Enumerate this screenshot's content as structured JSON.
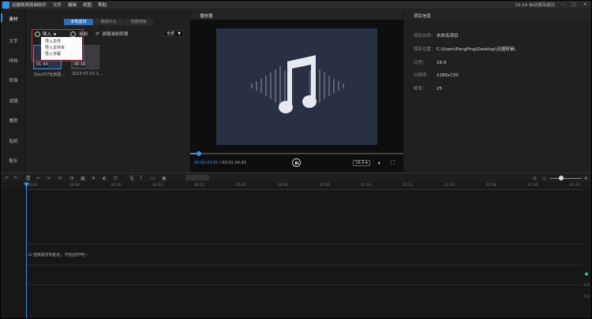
{
  "titlebar": {
    "app_title": "迅捷视频剪辑软件",
    "menu": [
      "文件",
      "编辑",
      "视图",
      "帮助"
    ],
    "save_status": "15:14 自动保存成功",
    "win_controls": [
      "–",
      "□",
      "✕"
    ]
  },
  "nav": [
    "素材",
    "文字",
    "特效",
    "转场",
    "滤镜",
    "叠附",
    "贴纸",
    "配乐"
  ],
  "library": {
    "tabs": [
      "本地素材",
      "视频片头",
      "背景特效"
    ],
    "import_label": "导入",
    "record_label": "录制",
    "capture_label": "屏幕录制转换",
    "filter_value": "全部",
    "dropdown_items": [
      "导入文件",
      "导入文件夹",
      "导入字幕"
    ],
    "thumbs": [
      {
        "duration": "01:34",
        "caption": "Day107远景图..."
      },
      {
        "duration": "00:16",
        "caption": "2023-07-23 1..."
      }
    ]
  },
  "player": {
    "title": "播放器",
    "current_time": "00:00:03.85",
    "total_time": "00:01:34.43",
    "ratio": "16:9",
    "progress": 0.04
  },
  "props": {
    "title": "项目信息",
    "rows": [
      {
        "k": "项目名称：",
        "v": "未命名项目"
      },
      {
        "k": "保存位置：",
        "v": "C:\\Users\\FengPing\\Desktop\\迅捷剪辑\\"
      },
      {
        "k": "比例：",
        "v": "16:9"
      },
      {
        "k": "分辨率：",
        "v": "1280x720"
      },
      {
        "k": "帧率：",
        "v": "25"
      }
    ]
  },
  "timeline": {
    "ticks": [
      "00:00",
      "00:08",
      "00:16",
      "00:24",
      "00:32",
      "00:40",
      "00:48",
      "00:56",
      "01:04",
      "01:12",
      "01:20",
      "01:28",
      "01:36",
      "01:44"
    ],
    "hint": "拖拽素材到此处，开始创作吧~",
    "meter": [
      "0.0",
      "0.0"
    ]
  },
  "colors": {
    "accent": "#3a8ee6",
    "highlight": "#e0233b"
  }
}
